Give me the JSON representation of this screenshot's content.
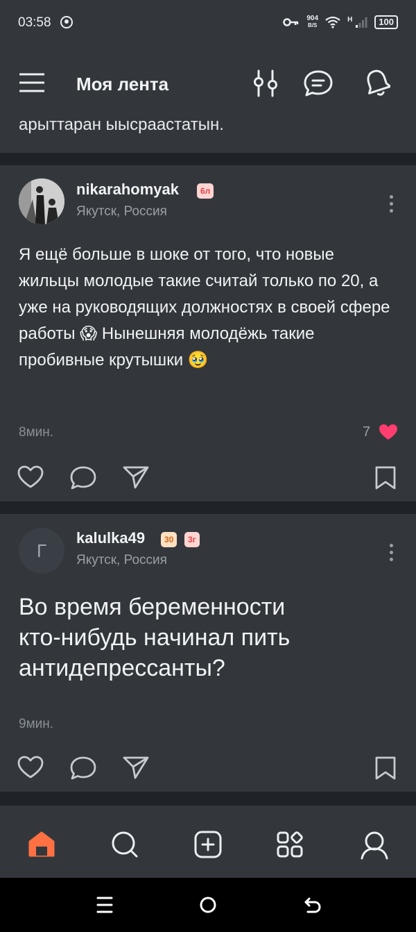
{
  "status_bar": {
    "time": "03:58",
    "speed_value": "904",
    "speed_unit": "B/S",
    "network": "H",
    "battery": "100"
  },
  "header": {
    "title": "Моя лента",
    "icons": [
      "menu-icon",
      "filter-icon",
      "chat-icon",
      "bell-icon"
    ]
  },
  "partial_post": {
    "text": "арыттаран ыысраастатын."
  },
  "posts": [
    {
      "username": "nikarahomyak",
      "badges": [
        "6л"
      ],
      "location": "Якутск, Россия",
      "text": "Я ещё больше в шоке от того, что новые жильцы молодые такие считай только по 20, а уже на руководящих должностях в своей сфере работы 😱 Нынешняя молодёжь такие пробивные крутышки 🥹",
      "time": "8мин.",
      "likes": "7"
    },
    {
      "username": "kalulka49",
      "avatar_letter": "Г",
      "badges": [
        "30",
        "3г"
      ],
      "location": "Якутск, Россия",
      "text": "Во время беременности кто-нибудь начинал пить антидепрессанты?",
      "time": "9мин."
    }
  ],
  "bottom_nav": [
    "home-icon",
    "search-icon",
    "add-post-icon",
    "services-icon",
    "profile-icon"
  ],
  "colors": {
    "accent": "#ff7043",
    "like": "#ff3d6e",
    "bg": "#33373c",
    "separator": "#1f2226"
  }
}
